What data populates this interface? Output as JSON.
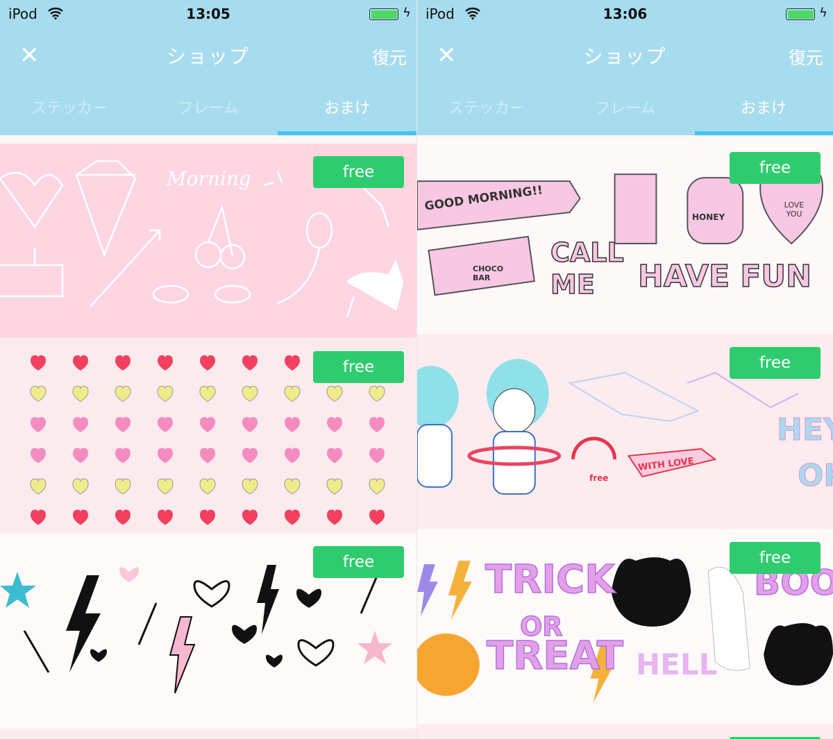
{
  "screens": [
    {
      "status": {
        "carrier": "iPod",
        "time": "13:05",
        "battery_level": 1.0
      },
      "nav": {
        "close_icon": "close-icon",
        "title": "ショップ",
        "restore": "復元"
      },
      "tabs": [
        {
          "label": "ステッカー",
          "active": false
        },
        {
          "label": "フレーム",
          "active": false
        },
        {
          "label": "おまけ",
          "active": true
        }
      ],
      "banners": [
        {
          "badge": "free",
          "bg": "#fdd6e1",
          "art_text": "Morning"
        },
        {
          "badge": "free",
          "bg": "#fcebee"
        },
        {
          "badge": "free",
          "bg": "#fefaf8"
        }
      ]
    },
    {
      "status": {
        "carrier": "iPod",
        "time": "13:06",
        "battery_level": 1.0
      },
      "nav": {
        "close_icon": "close-icon",
        "title": "ショップ",
        "restore": "復元"
      },
      "tabs": [
        {
          "label": "ステッカー",
          "active": false
        },
        {
          "label": "フレーム",
          "active": false
        },
        {
          "label": "おまけ",
          "active": true
        }
      ],
      "banners": [
        {
          "badge": "free",
          "bg": "#fdf9f8",
          "art_text": [
            "GOOD MORNING!!",
            "CALL ME",
            "HAVE FUN",
            "HONEY",
            "CHOCO BAR",
            "LOVE YOU"
          ]
        },
        {
          "badge": "free",
          "bg": "#fcecef",
          "art_text": [
            "WITH LOVE",
            "HEY",
            "OK",
            "free"
          ]
        },
        {
          "badge": "free",
          "bg": "#fefaf9",
          "art_text": [
            "TRICK",
            "OR",
            "TREAT",
            "HELL",
            "BOO!"
          ]
        }
      ]
    }
  ],
  "colors": {
    "header": "#a7dcef",
    "indicator": "#47c4ef",
    "free_badge": "#2fcc6f"
  },
  "heart_rows": [
    "#f2405e",
    "#f0ec8c",
    "#f58cbf",
    "#f58cbf",
    "#f0ec8c",
    "#f2405e"
  ]
}
